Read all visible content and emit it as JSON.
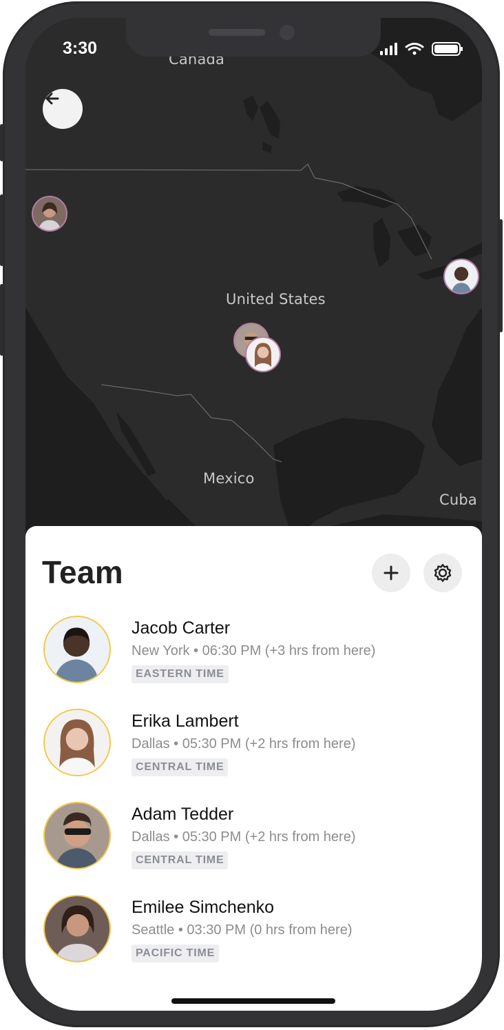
{
  "status_bar": {
    "time": "3:30"
  },
  "map": {
    "labels": {
      "canada": "Canada",
      "united_states": "United States",
      "mexico": "Mexico",
      "cuba": "Cuba"
    },
    "pins": [
      "Emilee Simchenko",
      "Jacob Carter",
      "Adam Tedder",
      "Erika Lambert"
    ]
  },
  "sheet": {
    "title": "Team",
    "members": [
      {
        "name": "Jacob Carter",
        "location": "New York",
        "time": "06:30 PM",
        "offset": "(+3 hrs from here)",
        "zone": "EASTERN TIME"
      },
      {
        "name": "Erika Lambert",
        "location": "Dallas",
        "time": "05:30 PM",
        "offset": "(+2 hrs from here)",
        "zone": "CENTRAL TIME"
      },
      {
        "name": "Adam Tedder",
        "location": "Dallas",
        "time": "05:30 PM",
        "offset": "(+2 hrs from here)",
        "zone": "CENTRAL TIME"
      },
      {
        "name": "Emilee Simchenko",
        "location": "Seattle",
        "time": "03:30 PM",
        "offset": "(0 hrs from here)",
        "zone": "PACIFIC TIME"
      }
    ]
  },
  "icons": {
    "back": "arrow-left-icon",
    "add": "plus-icon",
    "settings": "gear-icon"
  },
  "colors": {
    "map_land": "#2b2b2b",
    "map_water": "#1e1e1e",
    "avatar_ring": "#f2c94c",
    "pin_ring": "#b37ea4"
  }
}
